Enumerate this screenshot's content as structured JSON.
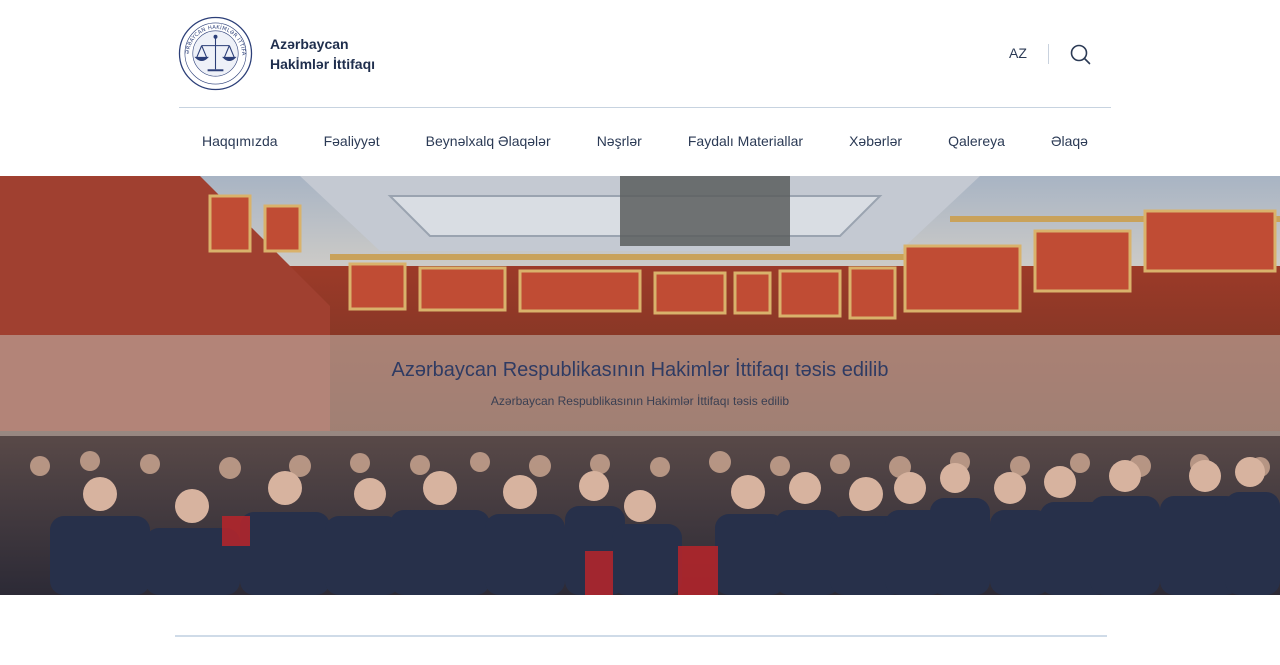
{
  "header": {
    "brand_line1": "Azərbaycan",
    "brand_line2": "Hakİmlər İttifaqı",
    "seal_text": "AZƏRBAYCAN HAKİMLƏR İTTİFAQI",
    "lang": "AZ"
  },
  "nav": {
    "items": [
      {
        "label": "Haqqımızda"
      },
      {
        "label": "Fəaliyyət"
      },
      {
        "label": "Beynəlxalq Əlaqələr"
      },
      {
        "label": "Nəşrlər"
      },
      {
        "label": "Faydalı Materiallar"
      },
      {
        "label": "Xəbərlər"
      },
      {
        "label": "Qalereya"
      },
      {
        "label": "Əlaqə"
      }
    ]
  },
  "hero": {
    "title": "Azərbaycan Respublikasının Hakimlər İttifaqı təsis edilib",
    "subtitle": "Azərbaycan Respublikasının Hakimlər İttifaqı təsis edilib"
  },
  "icons": {
    "logo": "scales-of-justice-seal",
    "search": "search-icon"
  },
  "colors": {
    "text": "#2b3a55",
    "rule": "#c7d3e0",
    "hall_wall": "#b2442e",
    "hall_gold": "#c9a25a"
  }
}
